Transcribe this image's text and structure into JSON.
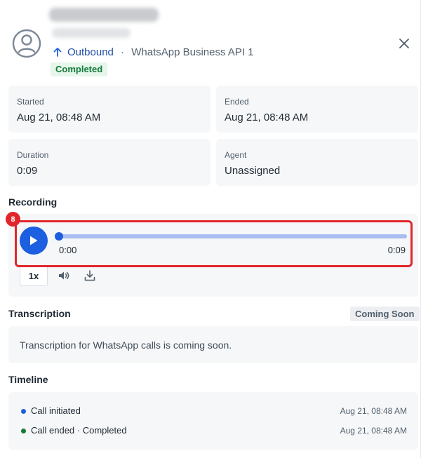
{
  "header": {
    "direction": "Outbound",
    "separator": " · ",
    "channel": "WhatsApp Business API 1",
    "status": "Completed"
  },
  "details": {
    "started": {
      "label": "Started",
      "value": "Aug 21, 08:48 AM"
    },
    "ended": {
      "label": "Ended",
      "value": "Aug 21, 08:48 AM"
    },
    "duration": {
      "label": "Duration",
      "value": "0:09"
    },
    "agent": {
      "label": "Agent",
      "value": "Unassigned"
    }
  },
  "recording": {
    "title": "Recording",
    "annotation_badge": "8",
    "current_time": "0:00",
    "total_time": "0:09",
    "progress_fraction": 0.0,
    "speed": "1x"
  },
  "transcription": {
    "title": "Transcription",
    "badge": "Coming Soon",
    "text": "Transcription for WhatsApp calls is coming soon."
  },
  "timeline": {
    "title": "Timeline",
    "events": [
      {
        "label": "Call initiated",
        "time": "Aug 21, 08:48 AM",
        "color": "#1c5fe0"
      },
      {
        "label": "Call ended · Completed",
        "time": "Aug 21, 08:48 AM",
        "color": "#137a3a"
      }
    ]
  },
  "colors": {
    "accent": "#1c5fe0",
    "success": "#137a3a",
    "highlight": "#e0262b"
  }
}
